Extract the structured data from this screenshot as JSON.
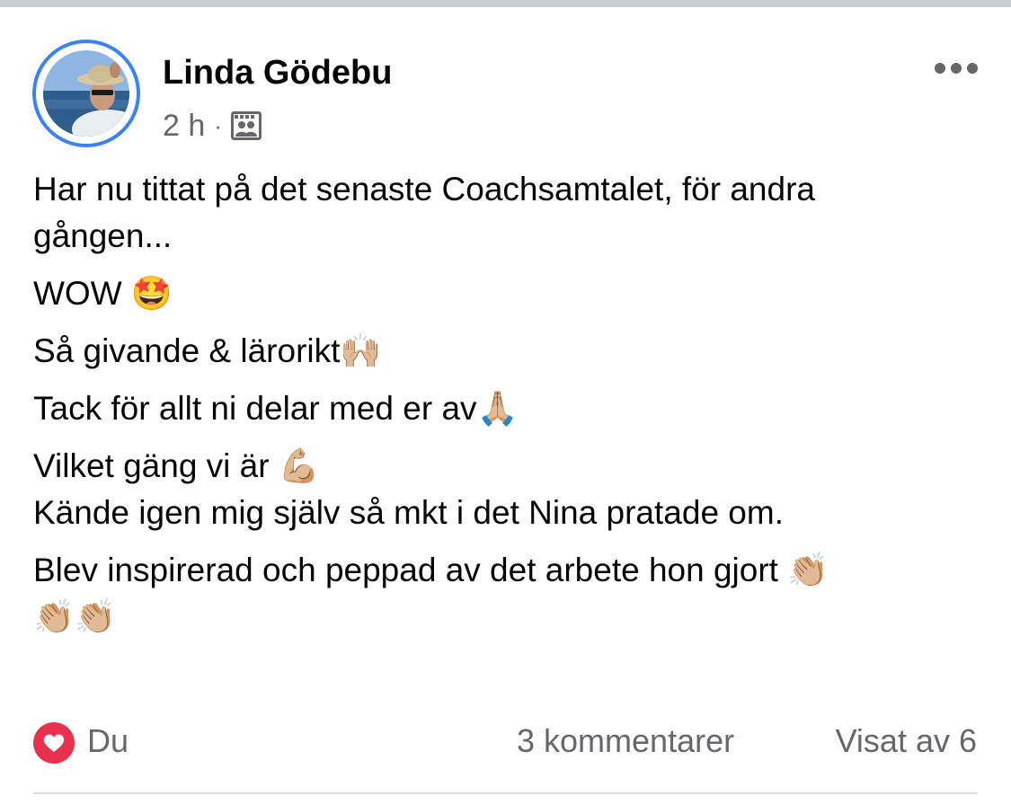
{
  "post": {
    "author": "Linda Gödebu",
    "time": "2 h",
    "separator": "·",
    "audience_icon": "group-audience-icon",
    "more_icon": "more-options-icon",
    "lines": [
      "Har nu tittat på det senaste Coachsamtalet, för andra",
      "gången...",
      "WOW 🤩",
      "Så givande & lärorikt🙌🏼",
      "Tack för allt ni delar med er av🙏🏼",
      "Vilket gäng vi är 💪🏼",
      "Kände igen mig själv så mkt i det Nina pratade om.",
      "Blev inspirerad och peppad av det arbete hon gjort 👏🏼",
      "👏🏼👏🏼"
    ]
  },
  "footer": {
    "reaction_icon": "heart-icon",
    "reactor": "Du",
    "comments": "3 kommentarer",
    "seen_by": "Visat av 6"
  },
  "colors": {
    "avatar_ring": "#3b82f6",
    "heart": "#e9304c",
    "secondary_text": "#65676b"
  }
}
